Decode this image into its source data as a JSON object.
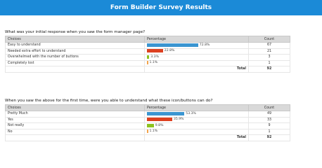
{
  "header": {
    "title": "Form Builder Survey Results"
  },
  "colors": {
    "header_bg": "#1b8ad7",
    "blue": "#3a95d1",
    "red": "#dd4020",
    "green": "#8dc21f",
    "orange": "#f3a44b"
  },
  "columns": {
    "choices": "Choices",
    "percentage": "Percentage",
    "count": "Count",
    "total_label": "Total"
  },
  "questions": [
    {
      "text": "What was your initial response when you saw the form manager page?",
      "rows": [
        {
          "choice": "Easy to understand",
          "percent": 72.8,
          "percent_label": "72.8%",
          "count": "67",
          "color": "#3a95d1"
        },
        {
          "choice": "Needed extra effort to understand",
          "percent": 22.8,
          "percent_label": "22.8%",
          "count": "21",
          "color": "#dd4020"
        },
        {
          "choice": "Overwhelmed with the number of buttons",
          "percent": 3.3,
          "percent_label": "3.3%",
          "count": "3",
          "color": "#8dc21f"
        },
        {
          "choice": "Completely lost",
          "percent": 1.1,
          "percent_label": "1.1%",
          "count": "1",
          "color": "#f3a44b"
        }
      ],
      "total": "92"
    },
    {
      "text": "When you saw the above for the first time, were you able to understand what these icon/buttons can do?",
      "rows": [
        {
          "choice": "Pretty Much",
          "percent": 53.3,
          "percent_label": "53.3%",
          "count": "49",
          "color": "#3a95d1"
        },
        {
          "choice": "Yes",
          "percent": 35.9,
          "percent_label": "35.9%",
          "count": "33",
          "color": "#dd4020"
        },
        {
          "choice": "Not really",
          "percent": 9.8,
          "percent_label": "9.8%",
          "count": "9",
          "color": "#8dc21f"
        },
        {
          "choice": "No",
          "percent": 1.1,
          "percent_label": "1.1%",
          "count": "1",
          "color": "#f3a44b"
        }
      ],
      "total": "92"
    }
  ]
}
